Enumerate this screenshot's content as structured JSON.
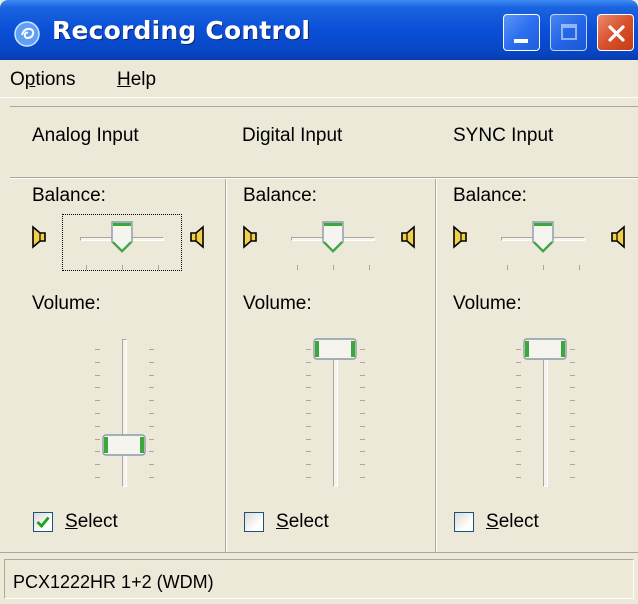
{
  "window": {
    "title": "Recording Control",
    "title_icon": "recording-app-icon"
  },
  "menu": {
    "options": "Options",
    "help": "Help"
  },
  "columns": [
    {
      "name": "Analog Input",
      "balance_label": "Balance:",
      "volume_label": "Volume:",
      "select_label": "Select",
      "selected": true,
      "balance_position": 0.5,
      "volume_level": 0.25,
      "balance_focused": true
    },
    {
      "name": "Digital Input",
      "balance_label": "Balance:",
      "volume_label": "Volume:",
      "select_label": "Select",
      "selected": false,
      "balance_position": 0.5,
      "volume_level": 1.0,
      "balance_focused": false
    },
    {
      "name": "SYNC Input",
      "balance_label": "Balance:",
      "volume_label": "Volume:",
      "select_label": "Select",
      "selected": false,
      "balance_position": 0.5,
      "volume_level": 1.0,
      "balance_focused": false
    }
  ],
  "status": {
    "device": "PCX1222HR 1+2 (WDM)"
  },
  "colors": {
    "titlebar": "#0a4fd6",
    "face": "#ece9d8",
    "thumb_accent": "#3aa83a",
    "checkmark": "#21a121"
  }
}
